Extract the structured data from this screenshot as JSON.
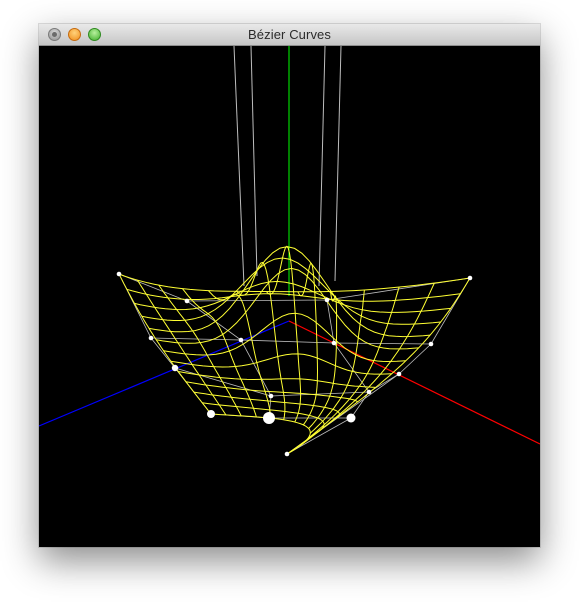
{
  "window": {
    "title": "Bézier Curves"
  },
  "colors": {
    "background": "#000000",
    "surface": "#ffff33",
    "control_net": "#bdbdbd",
    "axis_x": "#ff0000",
    "axis_y": "#00ff00",
    "axis_z": "#0000ff"
  },
  "icons": {
    "close": "close-button",
    "minimize": "minimize-button",
    "zoom": "zoom-button"
  }
}
